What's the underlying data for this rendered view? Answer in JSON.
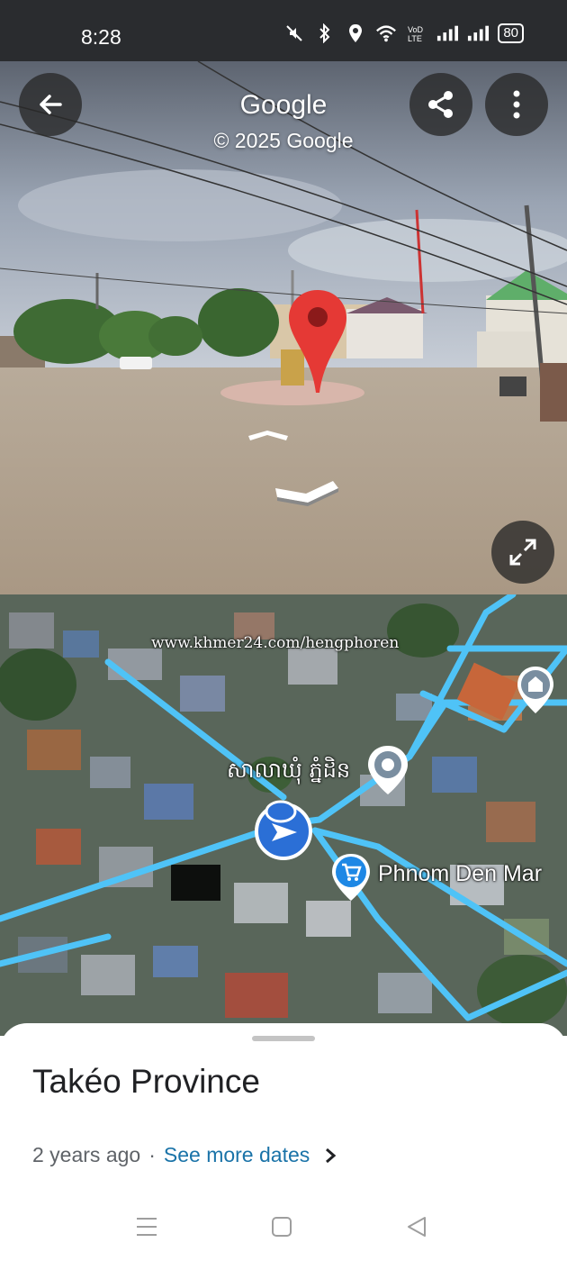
{
  "status_bar": {
    "time": "8:28",
    "battery": "80",
    "icons": [
      "mute-icon",
      "bluetooth-icon",
      "location-icon",
      "wifi-icon",
      "volte-icon",
      "signal-icon",
      "signal-icon",
      "battery-icon"
    ]
  },
  "street_view": {
    "title": "Google",
    "copyright": "© 2025 Google",
    "buttons": [
      "back-arrow-icon",
      "share-icon",
      "more-vert-icon",
      "expand-icon"
    ]
  },
  "map": {
    "watermark": "www.khmer24.com/hengphoren",
    "place_label": "សាលាឃុំ ភ្នំដិន",
    "market_label": "Phnom Den Mar"
  },
  "sheet": {
    "title": "Takéo Province",
    "age": "2 years ago",
    "separator": "·",
    "see_more": "See more dates"
  },
  "navbar": {
    "buttons": [
      "menu-icon",
      "home-square-icon",
      "back-triangle-icon"
    ]
  },
  "colors": {
    "accent_link": "#1a73a8",
    "pin_red": "#e53935",
    "map_road": "#4fc3f7",
    "status_bar_bg": "#2a2c2f"
  }
}
